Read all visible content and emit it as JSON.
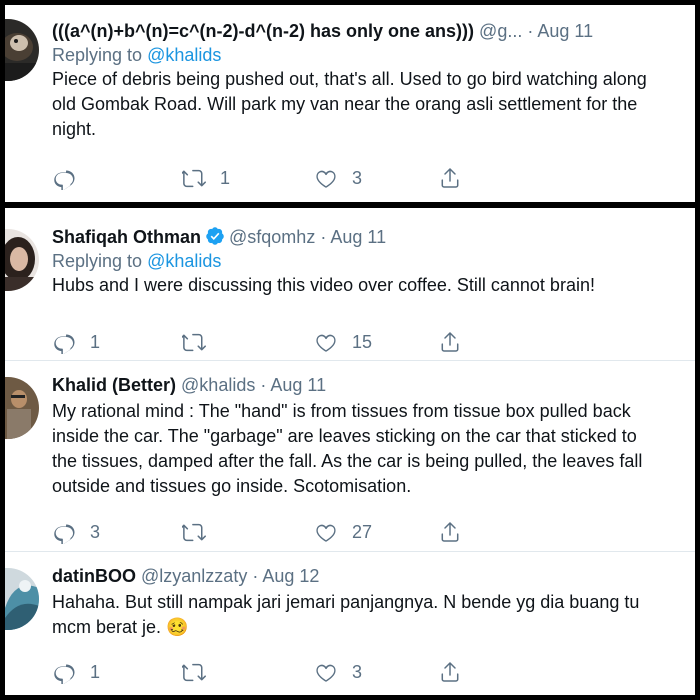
{
  "tweets": [
    {
      "name": "(((a^(n)+b^(n)=c^(n-2)-d^(n-2) has only one ans)))",
      "handle": "@g...",
      "separator": "·",
      "date": "Aug 11",
      "reply_prefix": "Replying to",
      "reply_to": "@khalids",
      "text_lines": [
        "Piece of debris being pushed out, that's all. Used to go bird watching along",
        "old Gombak Road. Will park my van near the orang asli settlement for the",
        "night."
      ],
      "replies": "",
      "retweets": "1",
      "likes": "3"
    },
    {
      "name": "Shafiqah Othman",
      "verified": true,
      "handle": "@sfqomhz",
      "separator": "·",
      "date": "Aug 11",
      "reply_prefix": "Replying to",
      "reply_to": "@khalids",
      "text_lines": [
        "Hubs and I were discussing this video over coffee. Still cannot brain!"
      ],
      "replies": "1",
      "retweets": "",
      "likes": "15"
    },
    {
      "name": "Khalid (Better)",
      "handle": "@khalids",
      "separator": "·",
      "date": "Aug 11",
      "text_lines": [
        "My rational mind : The \"hand\" is from tissues from tissue box pulled back",
        "inside the car. The \"garbage\" are leaves sticking on the car that sticked to",
        "the tissues, damped after the fall. As the car is being pulled, the leaves fall",
        "outside and tissues go inside. Scotomisation."
      ],
      "replies": "3",
      "retweets": "",
      "likes": "27"
    },
    {
      "name": "datinBOO",
      "handle": "@lzyanlzzaty",
      "separator": "·",
      "date": "Aug 12",
      "text_lines": [
        "Hahaha. But still nampak jari jemari panjangnya. N bende yg dia buang tu",
        "mcm berat je. 🥴"
      ],
      "replies": "1",
      "retweets": "",
      "likes": "3"
    }
  ],
  "icons": [
    "reply-icon",
    "retweet-icon",
    "like-icon",
    "share-icon",
    "verified-badge-icon"
  ],
  "colors": {
    "link": "#1b95e0",
    "muted": "#5b7083",
    "text": "#0f1419",
    "verified": "#1da1f2"
  }
}
